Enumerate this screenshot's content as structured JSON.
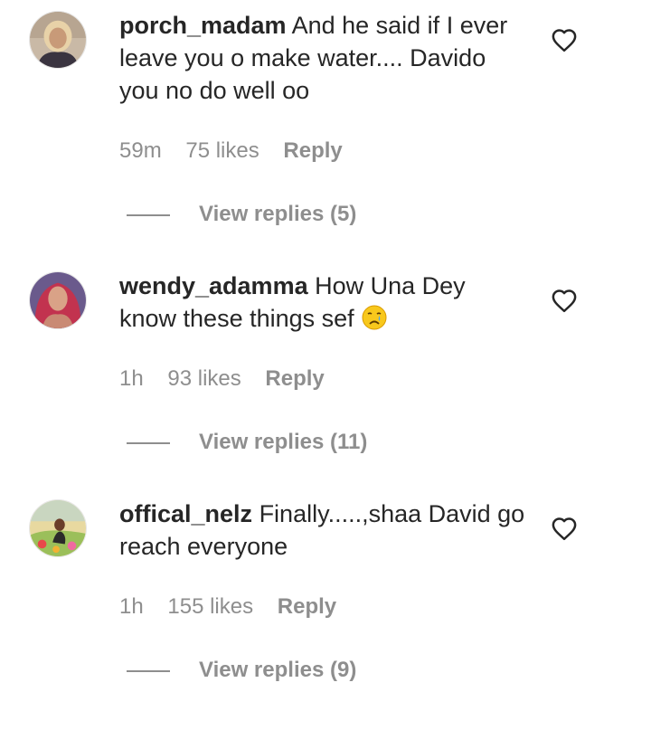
{
  "comments": [
    {
      "username": "porch_madam",
      "text": "And he said if I ever leave you o make water.... Davido you no do well oo",
      "time": "59m",
      "likes": "75 likes",
      "reply_label": "Reply",
      "view_replies": "View replies (5)",
      "avatar_icon": "avatar-photo-blonde-woman",
      "like_icon": "heart-outline-icon"
    },
    {
      "username": "wendy_adamma",
      "text": "How Una Dey know these things sef",
      "emoji": "crying-face-emoji",
      "time": "1h",
      "likes": "93 likes",
      "reply_label": "Reply",
      "view_replies": "View replies (11)",
      "avatar_icon": "avatar-photo-red-hair-woman",
      "like_icon": "heart-outline-icon"
    },
    {
      "username": "offical_nelz",
      "text": "Finally.....,shaa David go reach everyone",
      "time": "1h",
      "likes": "155 likes",
      "reply_label": "Reply",
      "view_replies": "View replies (9)",
      "avatar_icon": "avatar-photo-person-outdoors",
      "like_icon": "heart-outline-icon"
    }
  ],
  "colors": {
    "primary_text": "#262626",
    "secondary_text": "#8e8e8e",
    "background": "#ffffff"
  }
}
